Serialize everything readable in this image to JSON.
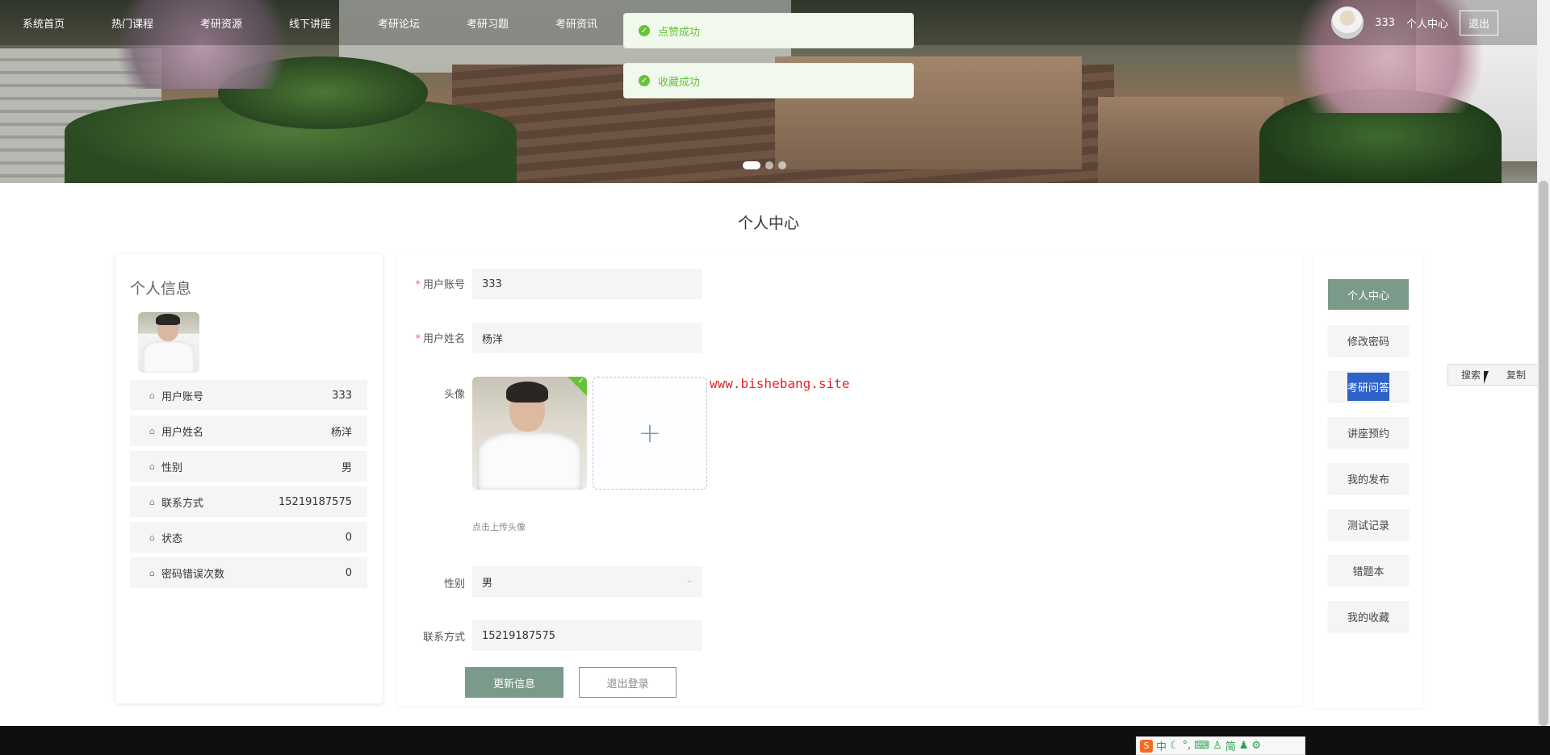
{
  "nav": {
    "items": [
      "系统首页",
      "热门课程",
      "考研资源",
      "线下讲座",
      "考研论坛",
      "考研习题",
      "考研资讯"
    ],
    "username": "333",
    "center_link": "个人中心",
    "logout": "退出"
  },
  "toasts": [
    "点赞成功",
    "收藏成功"
  ],
  "page_title": "个人中心",
  "profile_card": {
    "heading": "个人信息",
    "rows": [
      {
        "label": "用户账号",
        "value": "333"
      },
      {
        "label": "用户姓名",
        "value": "杨洋"
      },
      {
        "label": "性别",
        "value": "男"
      },
      {
        "label": "联系方式",
        "value": "15219187575"
      },
      {
        "label": "状态",
        "value": "0"
      },
      {
        "label": "密码错误次数",
        "value": "0"
      }
    ]
  },
  "form": {
    "account_label": "用户账号",
    "account_value": "333",
    "name_label": "用户姓名",
    "name_value": "杨洋",
    "avatar_label": "头像",
    "upload_plus": "+",
    "upload_hint": "点击上传头像",
    "gender_label": "性别",
    "gender_value": "男",
    "phone_label": "联系方式",
    "phone_value": "15219187575",
    "update_button": "更新信息",
    "logout_button": "退出登录",
    "required_mark": "*"
  },
  "watermark": "www.bishebang.site",
  "sidebar": {
    "items": [
      "个人中心",
      "修改密码",
      "考研问答",
      "讲座预约",
      "我的发布",
      "测试记录",
      "错题本",
      "我的收藏"
    ]
  },
  "context_menu": {
    "search": "搜索",
    "copy": "复制"
  },
  "ime": {
    "logo": "S",
    "mode": "中",
    "script": "简"
  },
  "colors": {
    "accent": "#7b9a89",
    "success": "#67c23a",
    "selection": "#2d62c8",
    "required": "#f56c6c"
  }
}
